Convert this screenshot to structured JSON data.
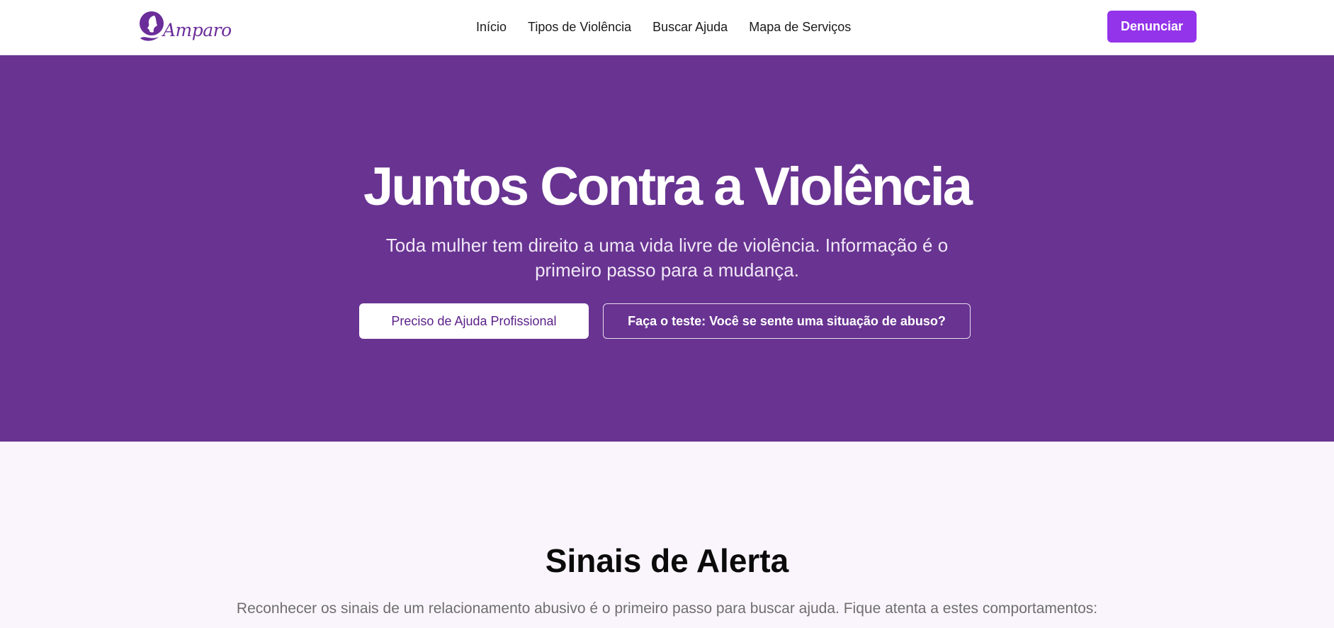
{
  "brand": {
    "name": "Amparo",
    "color": "#6b2d9a",
    "logo_icon": "woman-profile-icon"
  },
  "nav": {
    "items": [
      {
        "label": "Início"
      },
      {
        "label": "Tipos de Violência"
      },
      {
        "label": "Buscar Ajuda"
      },
      {
        "label": "Mapa de Serviços"
      }
    ],
    "report_button": "Denunciar",
    "accent": "#9333ea"
  },
  "hero": {
    "background": "#683391",
    "title": "Juntos Contra a Violência",
    "subtitle_line1": "Toda mulher tem direito a uma vida livre de violência. Informação é o",
    "subtitle_line2": "primeiro passo para a mudança.",
    "primary_button": "Preciso de Ajuda Profissional",
    "secondary_button": "Faça o teste: Você se sente uma situação de abuso?"
  },
  "alerts": {
    "title": "Sinais de Alerta",
    "description": "Reconhecer os sinais de um relacionamento abusivo é o primeiro passo para buscar ajuda. Fique atenta a estes comportamentos:"
  }
}
